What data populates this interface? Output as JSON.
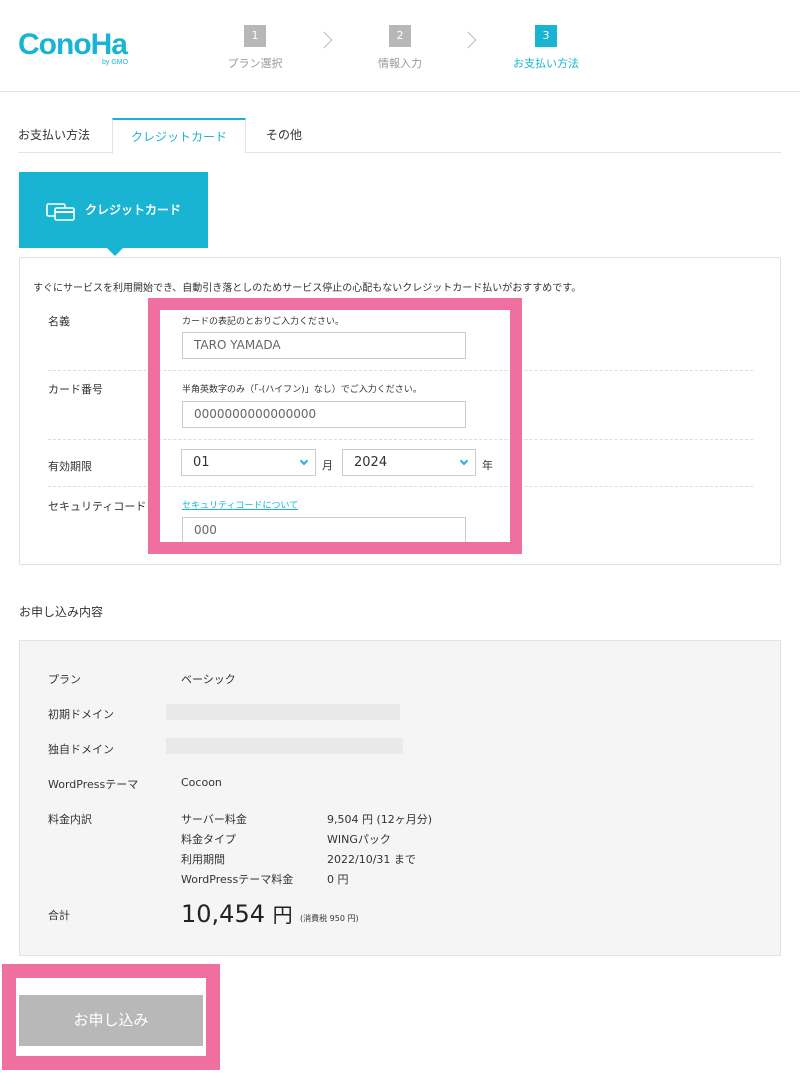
{
  "header": {
    "logo_text": "ConoHa",
    "logo_sub": "by GMO",
    "steps": [
      {
        "num": "1",
        "label": "プラン選択"
      },
      {
        "num": "2",
        "label": "情報入力"
      },
      {
        "num": "3",
        "label": "お支払い方法"
      }
    ]
  },
  "tabs": {
    "heading": "お支払い方法",
    "items": [
      "クレジットカード",
      "その他"
    ]
  },
  "method_card": {
    "label": "クレジットカード",
    "icon": "credit-card-icon"
  },
  "form": {
    "intro": "すぐにサービスを利用開始でき、自動引き落としのためサービス停止の心配もないクレジットカード払いがおすすめです。",
    "name": {
      "label": "名義",
      "hint": "カードの表記のとおりご入力ください。",
      "value": "TARO YAMADA"
    },
    "card": {
      "label": "カード番号",
      "hint": "半角英数字のみ（「-(ハイフン)」なし）でご入力ください。",
      "value": "0000000000000000"
    },
    "expiry": {
      "label": "有効期限",
      "month": "01",
      "month_unit": "月",
      "year": "2024",
      "year_unit": "年"
    },
    "security": {
      "label": "セキュリティコード",
      "link": "セキュリティコードについて",
      "value": "000"
    }
  },
  "summary": {
    "title": "お申し込み内容",
    "plan_label": "プラン",
    "plan_value": "ベーシック",
    "initial_domain_label": "初期ドメイン",
    "own_domain_label": "独自ドメイン",
    "theme_label": "WordPressテーマ",
    "theme_value": "Cocoon",
    "fee_label": "料金内訳",
    "fees": [
      {
        "k": "サーバー料金",
        "v": "9,504 円 (12ヶ月分)"
      },
      {
        "k": "料金タイプ",
        "v": "WINGパック"
      },
      {
        "k": "利用期間",
        "v": "2022/10/31 まで"
      },
      {
        "k": "WordPressテーマ料金",
        "v": "0 円"
      }
    ],
    "total_label": "合計",
    "total_value": "10,454",
    "total_unit": "円",
    "tax_note": "(消費税 950 円)"
  },
  "submit": {
    "label": "お申し込み"
  },
  "colors": {
    "accent": "#1ab4d3",
    "highlight": "#ee6fa0",
    "button": "#b8b8b8"
  }
}
